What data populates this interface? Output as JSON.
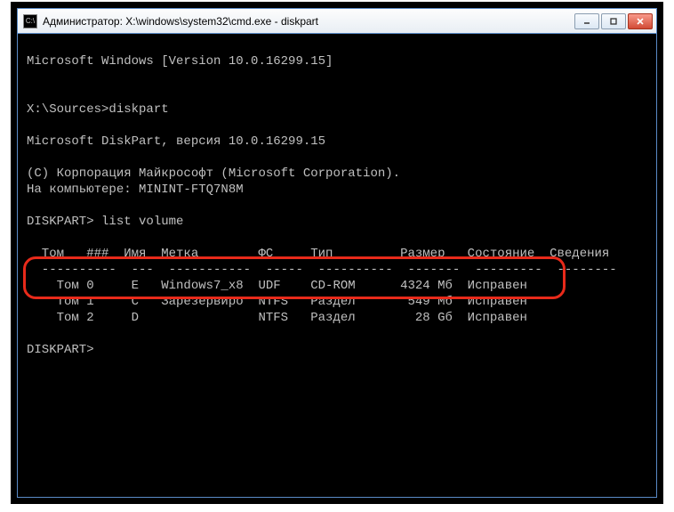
{
  "window": {
    "title": "Администратор: X:\\windows\\system32\\cmd.exe - diskpart",
    "icon_label": "C:\\"
  },
  "buttons": {
    "minimize": "Minimize",
    "maximize": "Maximize",
    "close": "Close"
  },
  "console": {
    "version_line": "Microsoft Windows [Version 10.0.16299.15]",
    "prompt1": "X:\\Sources>diskpart",
    "diskpart_version": "Microsoft DiskPart, версия 10.0.16299.15",
    "copyright": "(C) Корпорация Майкрософт (Microsoft Corporation).",
    "computer": "На компьютере: MININT-FTQ7N8M",
    "prompt2": "DISKPART> list volume",
    "header": "  Том   ###  Имя  Метка        ФС     Тип         Размер   Состояние  Сведения",
    "divider": "  ----------  ---  -----------  -----  ----------  -------  ---------  --------",
    "row0": "    Том 0     E   Windows7_x8  UDF    CD-ROM      4324 Мб  Исправен",
    "row1": "    Том 1     C   Зарезервиро  NTFS   Раздел       549 Мб  Исправен",
    "row2": "    Том 2     D                NTFS   Раздел        28 Gб  Исправен",
    "prompt3": "DISKPART>"
  },
  "volumes": [
    {
      "num": "Том 0",
      "ltr": "E",
      "label": "Windows7_x8",
      "fs": "UDF",
      "type": "CD-ROM",
      "size": "4324 Мб",
      "status": "Исправен",
      "info": ""
    },
    {
      "num": "Том 1",
      "ltr": "C",
      "label": "Зарезервиро",
      "fs": "NTFS",
      "type": "Раздел",
      "size": "549 Мб",
      "status": "Исправен",
      "info": ""
    },
    {
      "num": "Том 2",
      "ltr": "D",
      "label": "",
      "fs": "NTFS",
      "type": "Раздел",
      "size": "28 Gб",
      "status": "Исправен",
      "info": ""
    }
  ]
}
